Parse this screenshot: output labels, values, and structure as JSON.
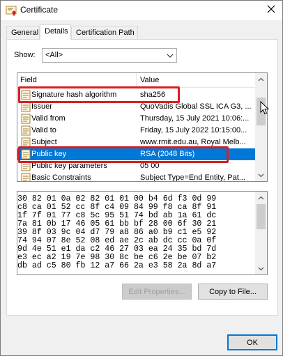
{
  "window": {
    "title": "Certificate",
    "icon": "certificate-icon",
    "close_icon": "close-icon"
  },
  "tabs": [
    {
      "label": "General"
    },
    {
      "label": "Details",
      "active": true
    },
    {
      "label": "Certification Path"
    }
  ],
  "show": {
    "label": "Show:",
    "selected": "<All>"
  },
  "list": {
    "columns": {
      "field": "Field",
      "value": "Value"
    },
    "rows": [
      {
        "field": "Signature hash algorithm",
        "value": "sha256"
      },
      {
        "field": "Issuer",
        "value": "QuoVadis Global SSL ICA G3, ..."
      },
      {
        "field": "Valid from",
        "value": "Thursday, 15 July 2021 10:06:..."
      },
      {
        "field": "Valid to",
        "value": "Friday, 15 July 2022 10:15:00..."
      },
      {
        "field": "Subject",
        "value": "www.rmit.edu.au, Royal Melb..."
      },
      {
        "field": "Public key",
        "value": "RSA (2048 Bits)",
        "selected": true
      },
      {
        "field": "Public key parameters",
        "value": "05 00"
      },
      {
        "field": "Basic Constraints",
        "value": "Subject Type=End Entity, Pat..."
      }
    ]
  },
  "hex_lines": [
    "30 82 01 0a 02 82 01 01 00 b4 6d f3 0d 99",
    "c8 ca 01 52 cc 8f c4 09 84 99 f8 ca 8f 91",
    "1f 7f 01 77 c8 5c 95 51 74 bd ab 1a 61 dc",
    "7a 81 0b 17 46 05 61 bb bf 28 00 6f 30 21",
    "39 8f 03 9c 04 d7 79 a8 86 a0 b9 c1 e5 92",
    "74 94 07 8e 52 08 ed ae 2c ab dc cc 0a 0f",
    "9d 4e 51 e1 da c2 46 27 03 ea 24 35 bd 7d",
    "e3 ec a2 19 7e 98 30 8c be c6 2e be 07 b2",
    "db ad c5 80 fb 12 a7 66 2a e3 58 2a 8d a7"
  ],
  "buttons": {
    "edit_properties": "Edit Properties...",
    "copy_to_file": "Copy to File...",
    "ok": "OK"
  },
  "colors": {
    "selection": "#0078d7",
    "annotation_box": "#d61f26"
  }
}
